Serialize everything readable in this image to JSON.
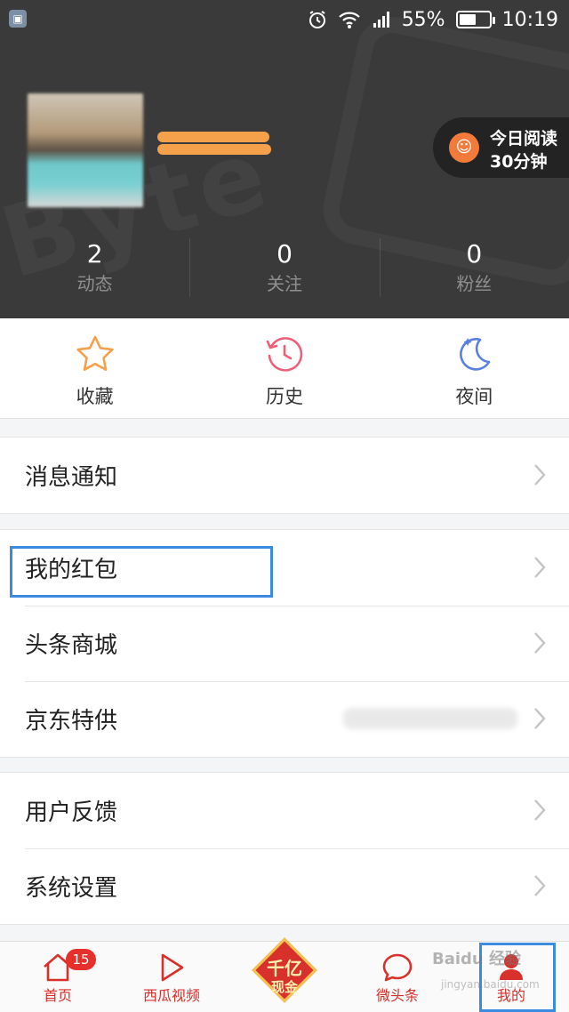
{
  "status_bar": {
    "battery_percent": "55%",
    "battery_level": 0.55,
    "time": "10:19",
    "icons": [
      "screenshot-icon",
      "alarm-icon",
      "wifi-icon",
      "signal-icon",
      "battery-icon"
    ]
  },
  "profile": {
    "reading_badge_line1": "今日阅读",
    "reading_badge_line2": "30分钟",
    "stats": [
      {
        "value": "2",
        "label": "动态"
      },
      {
        "value": "0",
        "label": "关注"
      },
      {
        "value": "0",
        "label": "粉丝"
      }
    ]
  },
  "quick_actions": [
    {
      "label": "收藏",
      "icon": "star-icon",
      "color": "#f5a04a"
    },
    {
      "label": "历史",
      "icon": "clock-icon",
      "color": "#ef5f77"
    },
    {
      "label": "夜间",
      "icon": "moon-icon",
      "color": "#5b7fe0"
    }
  ],
  "menu": {
    "group1": [
      {
        "label": "消息通知"
      }
    ],
    "group2": [
      {
        "label": "我的红包"
      },
      {
        "label": "头条商城"
      },
      {
        "label": "京东特供"
      }
    ],
    "group3": [
      {
        "label": "用户反馈"
      },
      {
        "label": "系统设置"
      }
    ]
  },
  "tabbar": {
    "home": {
      "label": "首页",
      "badge": "15"
    },
    "video": {
      "label": "西瓜视频"
    },
    "feature": {
      "line1": "千亿",
      "line2": "现金"
    },
    "weitoutiao": {
      "label": "微头条"
    },
    "me": {
      "label": "我的"
    }
  },
  "watermark": {
    "line1": "Baidu 经验",
    "line2": "jingyan.baidu.com"
  },
  "colors": {
    "accent_red": "#d8302b",
    "header_bg": "#3a3a3a",
    "highlight_blue": "#3b8be3"
  }
}
